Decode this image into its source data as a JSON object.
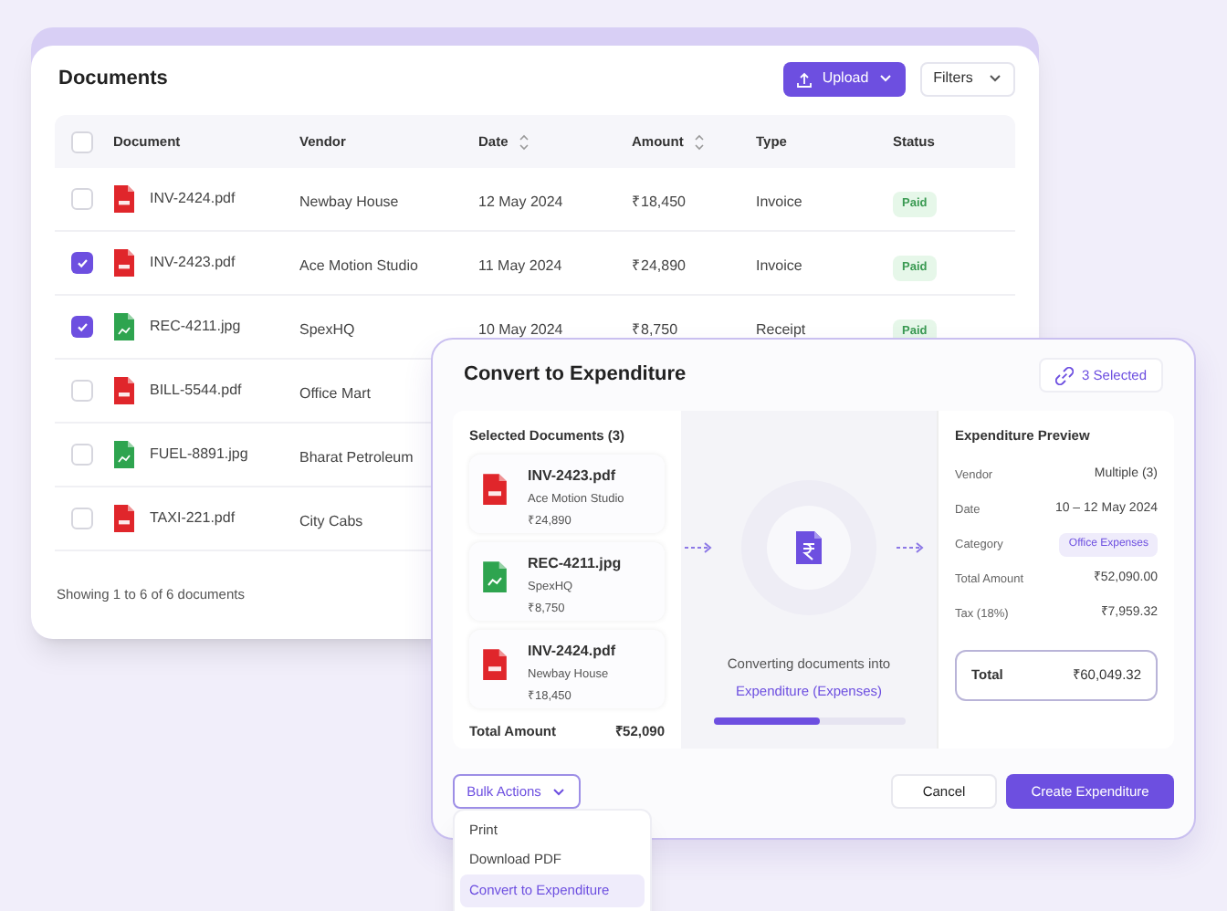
{
  "documents_panel": {
    "title": "Documents",
    "upload_button": "Upload",
    "filters_button": "Filters",
    "header_checked": false,
    "columns": [
      {
        "label": "Document",
        "sortable": false
      },
      {
        "label": "Vendor",
        "sortable": false
      },
      {
        "label": "Date",
        "sortable": true
      },
      {
        "label": "Amount",
        "sortable": true
      },
      {
        "label": "Type",
        "sortable": false
      },
      {
        "label": "Status",
        "sortable": false
      }
    ],
    "rows": [
      {
        "checked": false,
        "kind": "pdf",
        "document": "INV-2424.pdf",
        "vendor": "Newbay House",
        "date": "12 May 2024",
        "amount": "₹18,450",
        "type": "Invoice",
        "status": "Paid"
      },
      {
        "checked": true,
        "kind": "pdf",
        "document": "INV-2423.pdf",
        "vendor": "Ace Motion Studio",
        "date": "11 May 2024",
        "amount": "₹24,890",
        "type": "Invoice",
        "status": "Paid"
      },
      {
        "checked": true,
        "kind": "image",
        "document": "REC-4211.jpg",
        "vendor": "SpexHQ",
        "date": "10 May 2024",
        "amount": "₹8,750",
        "type": "Receipt",
        "status": "Paid"
      },
      {
        "checked": false,
        "kind": "pdf",
        "document": "BILL-5544.pdf",
        "vendor": "Office Mart"
      },
      {
        "checked": false,
        "kind": "image",
        "document": "FUEL-8891.jpg",
        "vendor": "Bharat Petroleum"
      },
      {
        "checked": false,
        "kind": "pdf",
        "document": "TAXI-221.pdf",
        "vendor": "City Cabs"
      }
    ],
    "footer": "Showing 1 to 6 of 6 documents"
  },
  "convert_dialog": {
    "title": "Convert to Expenditure",
    "selected_badge": "3 Selected",
    "selected_documents": {
      "title": "Selected Documents (3)",
      "items": [
        {
          "kind": "pdf",
          "name": "INV-2423.pdf",
          "vendor": "Ace Motion Studio",
          "amount": "₹24,890"
        },
        {
          "kind": "image",
          "name": "REC-4211.jpg",
          "vendor": "SpexHQ",
          "amount": "₹8,750"
        },
        {
          "kind": "pdf",
          "name": "INV-2424.pdf",
          "vendor": "Newbay House",
          "amount": "₹18,450"
        }
      ],
      "total_label": "Total Amount",
      "total_value": "₹52,090"
    },
    "conversion": {
      "line_1": "Converting documents into",
      "line_2": "Expenditure (Expenses)",
      "level": 0.56
    },
    "preview": {
      "title": "Expenditure Preview",
      "fields": [
        {
          "kind": "text",
          "label": "Vendor",
          "value": "Multiple (3)"
        },
        {
          "kind": "text",
          "label": "Date",
          "value": "10 – 12 May 2024"
        },
        {
          "kind": "tag",
          "label": "Category",
          "value": "Office Expenses"
        },
        {
          "kind": "text",
          "label": "Total Amount",
          "value": "₹52,090.00"
        },
        {
          "kind": "text",
          "label": "Tax (18%)",
          "value": "₹7,959.32"
        }
      ],
      "total_label": "Total",
      "total_value": "₹60,049.32"
    },
    "bulk_actions_button": "Bulk Actions",
    "cancel_button": "Cancel",
    "create_button": "Create Expenditure"
  },
  "bulk_menu": {
    "items": [
      {
        "label": "Print",
        "selected": false
      },
      {
        "label": "Download PDF",
        "selected": false
      },
      {
        "label": "Convert to Expenditure",
        "selected": true
      }
    ]
  }
}
